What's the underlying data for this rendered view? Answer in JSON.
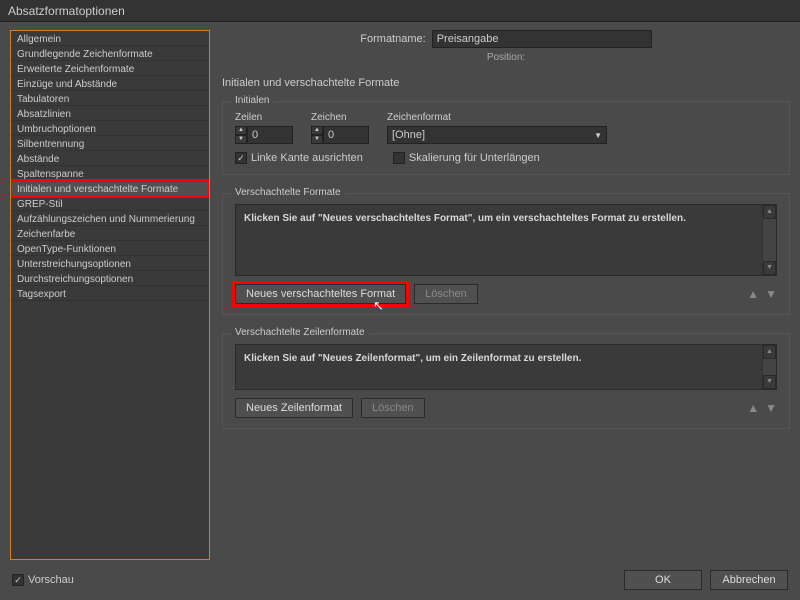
{
  "window": {
    "title": "Absatzformatoptionen"
  },
  "sidebar": {
    "items": [
      {
        "label": "Allgemein"
      },
      {
        "label": "Grundlegende Zeichenformate"
      },
      {
        "label": "Erweiterte Zeichenformate"
      },
      {
        "label": "Einzüge und Abstände"
      },
      {
        "label": "Tabulatoren"
      },
      {
        "label": "Absatzlinien"
      },
      {
        "label": "Umbruchoptionen"
      },
      {
        "label": "Silbentrennung"
      },
      {
        "label": "Abstände"
      },
      {
        "label": "Spaltenspanne"
      },
      {
        "label": "Initialen und verschachtelte Formate",
        "selected": true,
        "highlighted": true
      },
      {
        "label": "GREP-Stil"
      },
      {
        "label": "Aufzählungszeichen und Nummerierung"
      },
      {
        "label": "Zeichenfarbe"
      },
      {
        "label": "OpenType-Funktionen"
      },
      {
        "label": "Unterstreichungsoptionen"
      },
      {
        "label": "Durchstreichungsoptionen"
      },
      {
        "label": "Tagsexport"
      }
    ]
  },
  "main": {
    "formatname_label": "Formatname:",
    "formatname_value": "Preisangabe",
    "position_label": "Position:",
    "section_title": "Initialen und verschachtelte Formate",
    "initialen": {
      "legend": "Initialen",
      "zeilen_label": "Zeilen",
      "zeilen_value": "0",
      "zeichen_label": "Zeichen",
      "zeichen_value": "0",
      "zeichenformat_label": "Zeichenformat",
      "zeichenformat_value": "[Ohne]",
      "linke_kante_label": "Linke Kante ausrichten",
      "linke_kante_checked": true,
      "skalierung_label": "Skalierung für Unterlängen",
      "skalierung_checked": false
    },
    "nested": {
      "legend": "Verschachtelte Formate",
      "hint": "Klicken Sie auf \"Neues verschachteltes Format\", um ein verschachteltes Format zu erstellen.",
      "new_btn": "Neues verschachteltes Format",
      "delete_btn": "Löschen"
    },
    "lines": {
      "legend": "Verschachtelte Zeilenformate",
      "hint": "Klicken Sie auf \"Neues Zeilenformat\", um ein Zeilenformat zu erstellen.",
      "new_btn": "Neues Zeilenformat",
      "delete_btn": "Löschen"
    }
  },
  "footer": {
    "preview_label": "Vorschau",
    "preview_checked": true,
    "ok_label": "OK",
    "cancel_label": "Abbrechen"
  }
}
